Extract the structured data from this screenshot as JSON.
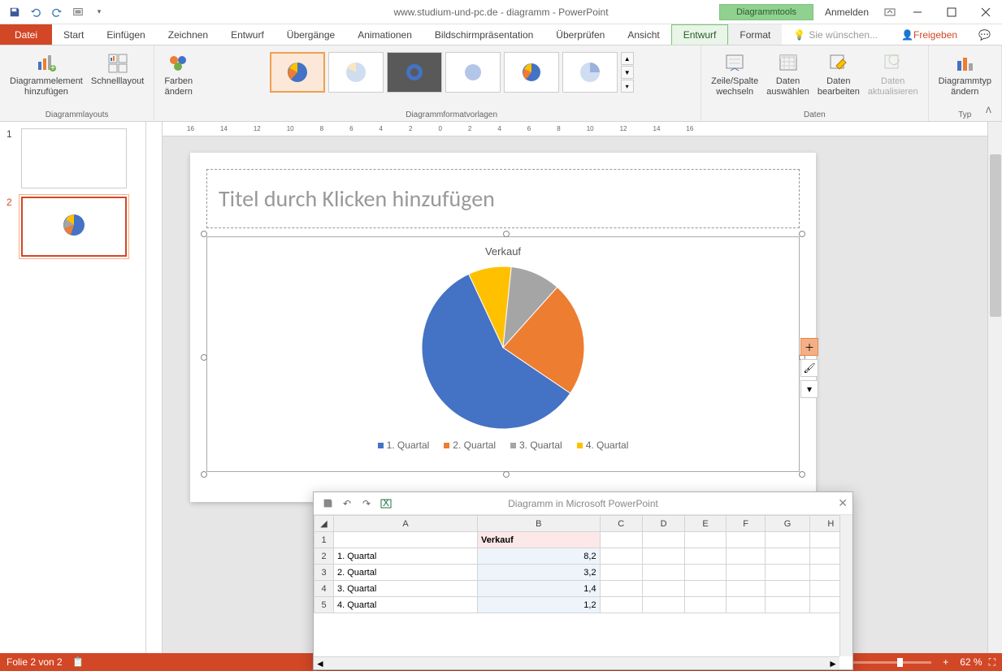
{
  "app": {
    "title": "www.studium-und-pc.de - diagramm - PowerPoint",
    "chart_tools": "Diagrammtools",
    "sign_in": "Anmelden"
  },
  "tabs": {
    "datei": "Datei",
    "start": "Start",
    "einfuegen": "Einfügen",
    "zeichnen": "Zeichnen",
    "entwurf": "Entwurf",
    "uebergaenge": "Übergänge",
    "animationen": "Animationen",
    "bildschirm": "Bildschirmpräsentation",
    "ueberpruefen": "Überprüfen",
    "ansicht": "Ansicht",
    "entwurf2": "Entwurf",
    "format": "Format",
    "tell_me": "Sie wünschen...",
    "freigeben": "Freigeben"
  },
  "ribbon": {
    "add_element": "Diagrammelement\nhinzufügen",
    "quick_layout": "Schnelllayout",
    "layouts_group": "Diagrammlayouts",
    "change_colors": "Farben\nändern",
    "styles_group": "Diagrammformatvorlagen",
    "switch_rc": "Zeile/Spalte\nwechseln",
    "select_data": "Daten\nauswählen",
    "edit_data": "Daten\nbearbeiten",
    "refresh_data": "Daten\naktualisieren",
    "data_group": "Daten",
    "change_type": "Diagrammtyp\nändern",
    "type_group": "Typ"
  },
  "slides": {
    "n1": "1",
    "n2": "2"
  },
  "slide": {
    "title_placeholder": "Titel durch Klicken hinzufügen"
  },
  "chart_data": {
    "type": "pie",
    "title": "Verkauf",
    "categories": [
      "1. Quartal",
      "2. Quartal",
      "3. Quartal",
      "4. Quartal"
    ],
    "values": [
      8.2,
      3.2,
      1.4,
      1.2
    ],
    "colors": [
      "#4472c4",
      "#ed7d31",
      "#a5a5a5",
      "#ffc000"
    ],
    "legend_position": "bottom"
  },
  "datasheet": {
    "title": "Diagramm in Microsoft PowerPoint",
    "header": "Verkauf",
    "cols": [
      "A",
      "B",
      "C",
      "D",
      "E",
      "F",
      "G",
      "H"
    ],
    "rows": [
      {
        "n": "1",
        "a": "",
        "b": "Verkauf"
      },
      {
        "n": "2",
        "a": "1. Quartal",
        "b": "8,2"
      },
      {
        "n": "3",
        "a": "2. Quartal",
        "b": "3,2"
      },
      {
        "n": "4",
        "a": "3. Quartal",
        "b": "1,4"
      },
      {
        "n": "5",
        "a": "4. Quartal",
        "b": "1,2"
      }
    ]
  },
  "status": {
    "slide_count": "Folie 2 von 2",
    "zoom": "62 %"
  },
  "ruler": [
    "16",
    "14",
    "12",
    "10",
    "8",
    "6",
    "4",
    "2",
    "0",
    "2",
    "4",
    "6",
    "8",
    "10",
    "12",
    "14",
    "16"
  ]
}
